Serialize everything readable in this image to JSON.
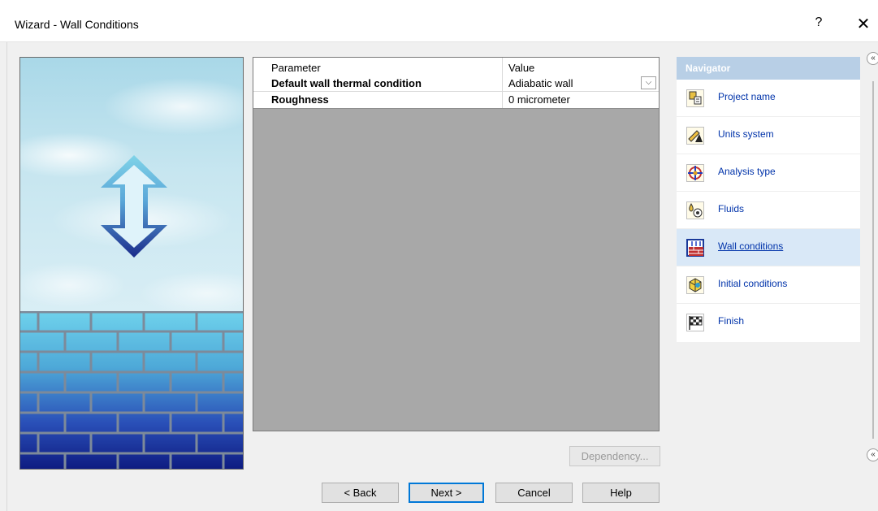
{
  "window": {
    "title": "Wizard - Wall Conditions",
    "help_label": "?",
    "close_label": "✕"
  },
  "grid": {
    "header": {
      "parameter": "Parameter",
      "value": "Value"
    },
    "rows": [
      {
        "parameter": "Default wall thermal condition",
        "value": "Adiabatic wall",
        "has_dropdown": true
      },
      {
        "parameter": "Roughness",
        "value": "0 micrometer",
        "has_dropdown": false
      }
    ],
    "dropdown_glyph": "⌵"
  },
  "buttons": {
    "dependency": "Dependency...",
    "back": "< Back",
    "next": "Next >",
    "cancel": "Cancel",
    "help": "Help"
  },
  "navigator": {
    "title": "Navigator",
    "items": [
      {
        "label": "Project name",
        "icon": "project-name-icon",
        "selected": false
      },
      {
        "label": "Units system",
        "icon": "units-system-icon",
        "selected": false
      },
      {
        "label": "Analysis type",
        "icon": "analysis-type-icon",
        "selected": false
      },
      {
        "label": "Fluids",
        "icon": "fluids-icon",
        "selected": false
      },
      {
        "label": "Wall conditions",
        "icon": "wall-conditions-icon",
        "selected": true
      },
      {
        "label": "Initial conditions",
        "icon": "initial-conditions-icon",
        "selected": false
      },
      {
        "label": "Finish",
        "icon": "finish-flag-icon",
        "selected": false
      }
    ],
    "collapse_glyph": "«"
  },
  "colors": {
    "nav_header_bg": "#b8cfe6",
    "nav_selected_bg": "#d9e8f7",
    "link_blue": "#0033aa",
    "grid_empty_bg": "#a8a8a8"
  }
}
